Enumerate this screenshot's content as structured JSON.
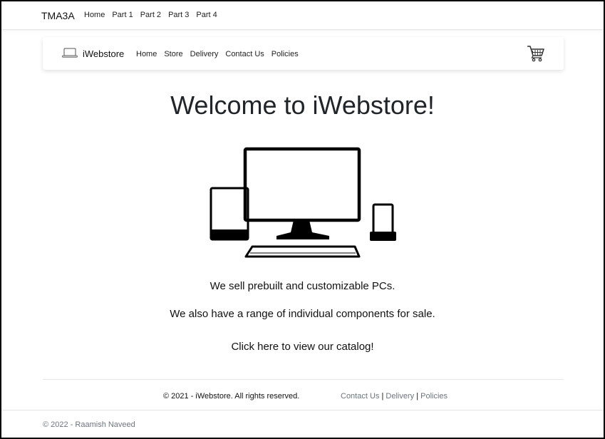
{
  "topnav": {
    "brand": "TMA3A",
    "links": [
      "Home",
      "Part 1",
      "Part 2",
      "Part 3",
      "Part 4"
    ]
  },
  "storenav": {
    "brand": "iWebstore",
    "links": [
      "Home",
      "Store",
      "Delivery",
      "Contact Us",
      "Policies"
    ],
    "icons": {
      "logo": "laptop-icon",
      "cart": "shopping-cart-icon"
    }
  },
  "main": {
    "heading": "Welcome to iWebstore!",
    "hero_icon": "devices-illustration",
    "line1": "We sell prebuilt and customizable PCs.",
    "line2": "We also have a range of individual components for sale.",
    "cta": "Click here to view our catalog!"
  },
  "footer": {
    "copyright": "© 2021 - iWebstore. All rights reserved.",
    "links": [
      "Contact Us",
      "Delivery",
      "Policies"
    ],
    "separator": "|"
  },
  "bottom": {
    "copyright": "© 2022 - Raamish Naveed"
  },
  "colors": {
    "link_muted": "#6c757d",
    "text": "#212529"
  }
}
